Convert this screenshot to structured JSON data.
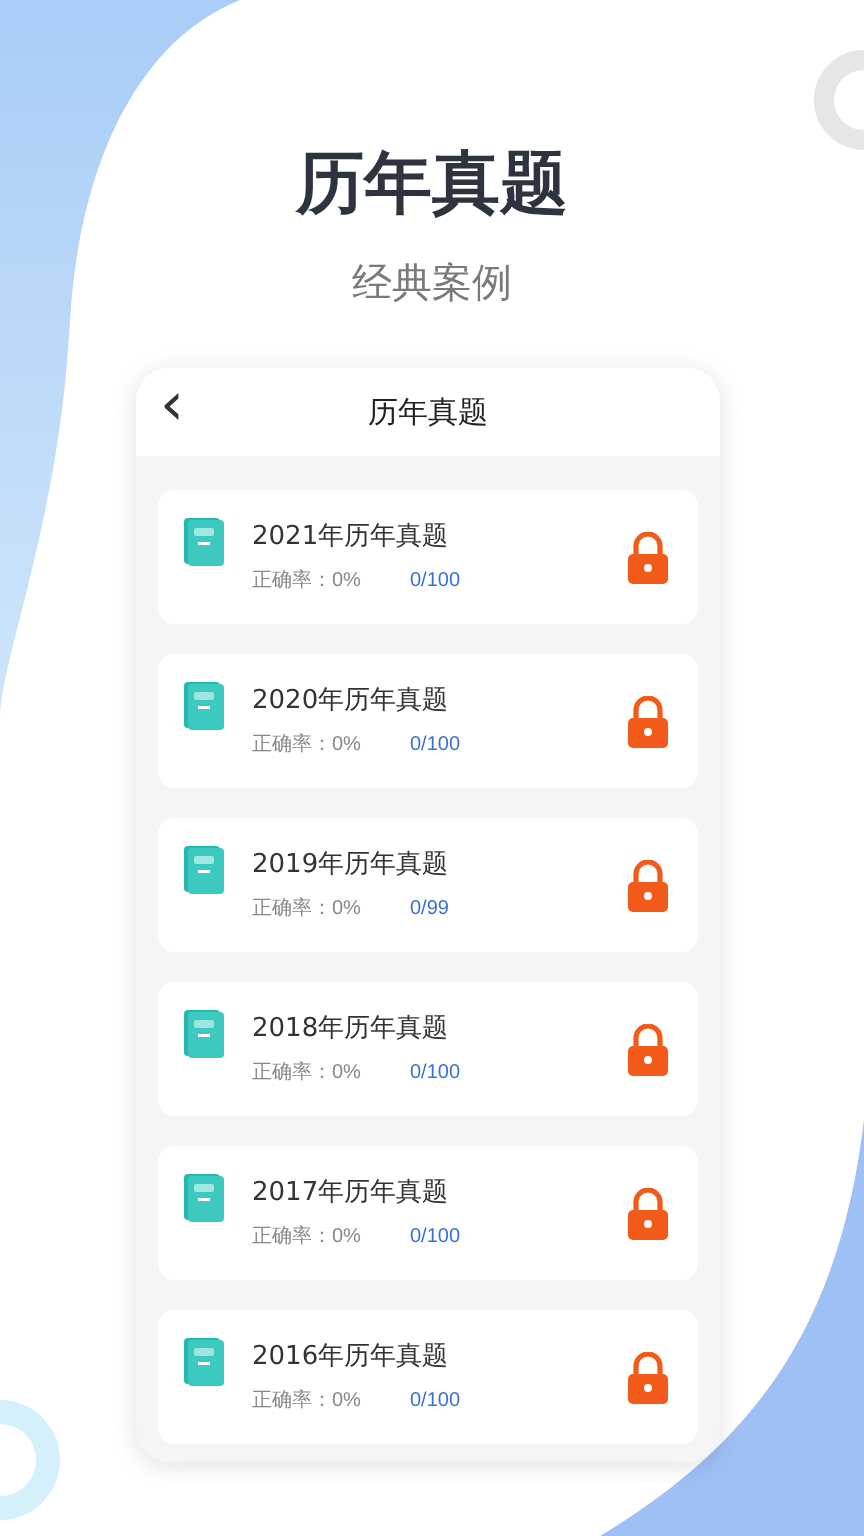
{
  "headline": "历年真题",
  "subtitle": "经典案例",
  "screen": {
    "back_icon": "‹",
    "title": "历年真题",
    "items": [
      {
        "title": "2021年历年真题",
        "accuracy": "正确率：0%",
        "progress": "0/100",
        "locked": true
      },
      {
        "title": "2020年历年真题",
        "accuracy": "正确率：0%",
        "progress": "0/100",
        "locked": true
      },
      {
        "title": "2019年历年真题",
        "accuracy": "正确率：0%",
        "progress": "0/99",
        "locked": true
      },
      {
        "title": "2018年历年真题",
        "accuracy": "正确率：0%",
        "progress": "0/100",
        "locked": true
      },
      {
        "title": "2017年历年真题",
        "accuracy": "正确率：0%",
        "progress": "0/100",
        "locked": true
      },
      {
        "title": "2016年历年真题",
        "accuracy": "正确率：0%",
        "progress": "0/100",
        "locked": true
      }
    ]
  }
}
